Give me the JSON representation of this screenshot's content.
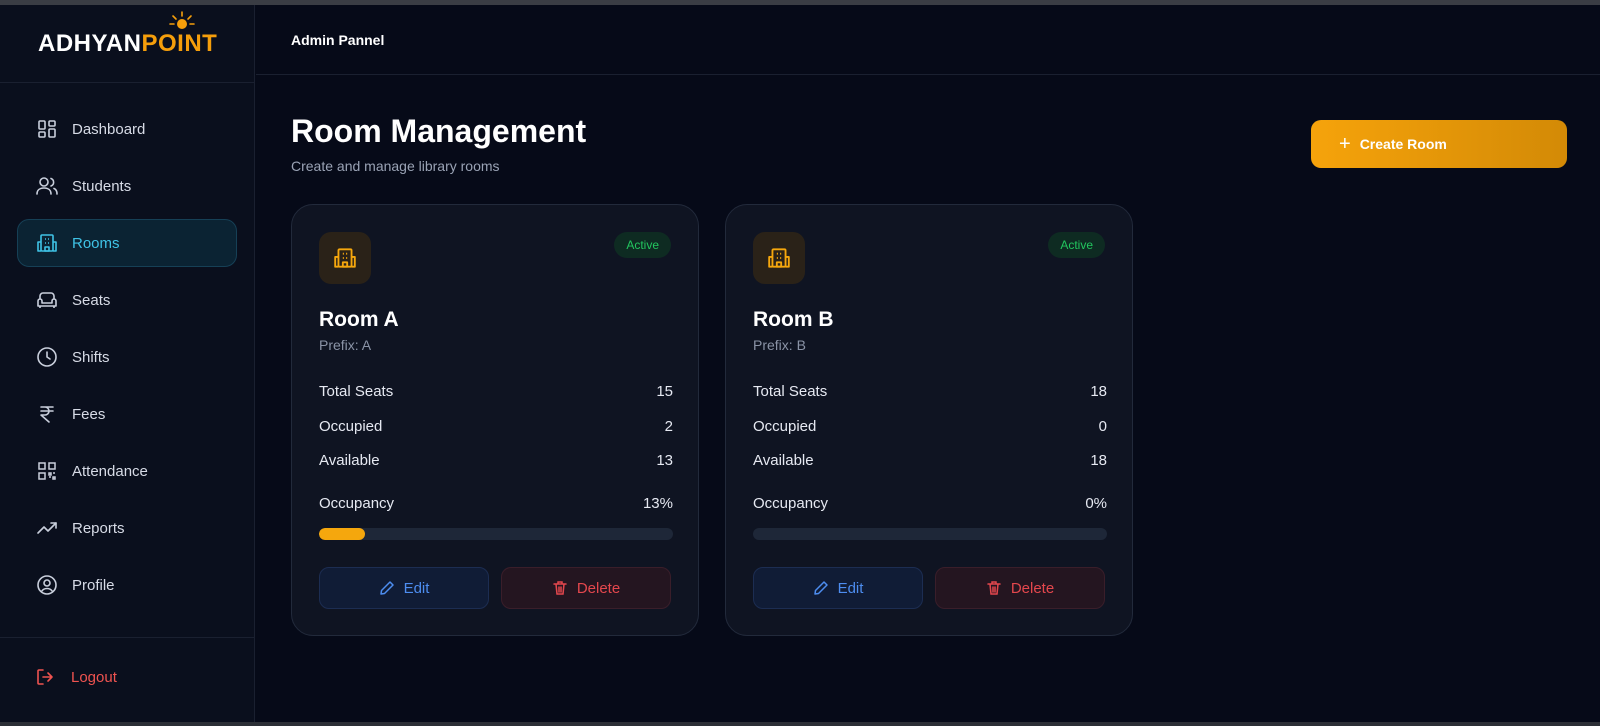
{
  "brand": {
    "white": "ADHYAN",
    "orange": "POINT"
  },
  "header": {
    "title": "Admin Pannel"
  },
  "sidebar": {
    "items": [
      {
        "label": "Dashboard",
        "icon": "dashboard-icon",
        "active": false
      },
      {
        "label": "Students",
        "icon": "users-icon",
        "active": false
      },
      {
        "label": "Rooms",
        "icon": "building-icon",
        "active": true
      },
      {
        "label": "Seats",
        "icon": "sofa-icon",
        "active": false
      },
      {
        "label": "Shifts",
        "icon": "clock-icon",
        "active": false
      },
      {
        "label": "Fees",
        "icon": "rupee-icon",
        "active": false
      },
      {
        "label": "Attendance",
        "icon": "qr-code-icon",
        "active": false
      },
      {
        "label": "Reports",
        "icon": "trending-up-icon",
        "active": false
      },
      {
        "label": "Profile",
        "icon": "user-circle-icon",
        "active": false
      }
    ],
    "logout": "Logout"
  },
  "main": {
    "title": "Room Management",
    "subtitle": "Create and manage library rooms",
    "create_button": "Create Room"
  },
  "rooms": [
    {
      "status": "Active",
      "name": "Room A",
      "prefix": "Prefix: A",
      "total_label": "Total Seats",
      "total": "15",
      "occupied_label": "Occupied",
      "occupied": "2",
      "available_label": "Available",
      "available": "13",
      "occupancy_label": "Occupancy",
      "occupancy": "13%",
      "occupancy_fraction": 0.13,
      "edit": "Edit",
      "delete": "Delete"
    },
    {
      "status": "Active",
      "name": "Room B",
      "prefix": "Prefix: B",
      "total_label": "Total Seats",
      "total": "18",
      "occupied_label": "Occupied",
      "occupied": "0",
      "available_label": "Available",
      "available": "18",
      "occupancy_label": "Occupancy",
      "occupancy": "0%",
      "occupancy_fraction": 0,
      "edit": "Edit",
      "delete": "Delete"
    }
  ],
  "colors": {
    "accent": "#f59e0b",
    "active_nav": "#3fc3e6",
    "status_green": "#22c55e",
    "danger": "#ef5350",
    "edit_blue": "#4d8df0"
  }
}
